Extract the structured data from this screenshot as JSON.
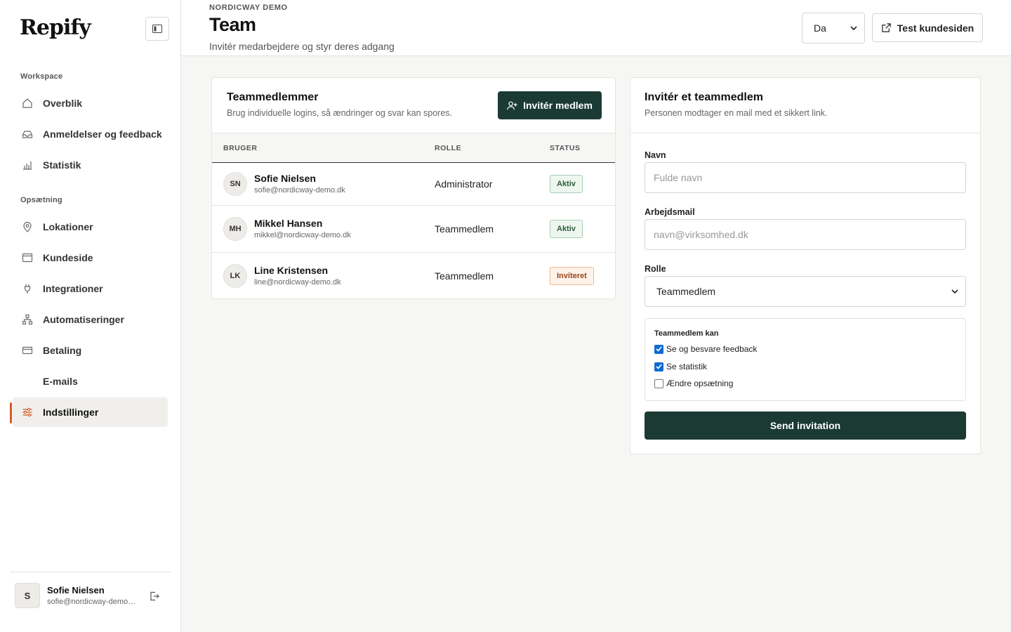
{
  "sidebar": {
    "logo": "Repify",
    "sections": {
      "workspace": "Workspace",
      "setup": "Opsætning"
    },
    "items": [
      {
        "label": "Overblik",
        "icon": "home-icon"
      },
      {
        "label": "Anmeldelser og feedback",
        "icon": "inbox-icon"
      },
      {
        "label": "Statistik",
        "icon": "bar-chart-icon"
      },
      {
        "label": "Lokationer",
        "icon": "map-pin-icon"
      },
      {
        "label": "Kundeside",
        "icon": "browser-window-icon"
      },
      {
        "label": "Integrationer",
        "icon": "plug-icon"
      },
      {
        "label": "Automatiseringer",
        "icon": "workflow-icon"
      },
      {
        "label": "Betaling",
        "icon": "credit-card-icon"
      },
      {
        "label": "E-mails",
        "icon": ""
      },
      {
        "label": "Indstillinger",
        "icon": "sliders-icon",
        "active": true
      }
    ],
    "user": {
      "initial": "S",
      "name": "Sofie Nielsen",
      "email": "sofie@nordicway-demo.dk"
    }
  },
  "header": {
    "org": "NORDICWAY DEMO",
    "title": "Team",
    "subtitle": "Invitér medarbejdere og styr deres adgang",
    "language": "Da",
    "test_button": "Test kundesiden"
  },
  "team": {
    "title": "Teammedlemmer",
    "subtitle": "Brug individuelle logins, så ændringer og svar kan spores.",
    "invite_button": "Invitér medlem",
    "columns": [
      "BRUGER",
      "ROLLE",
      "STATUS"
    ],
    "members": [
      {
        "initials": "SN",
        "name": "Sofie Nielsen",
        "email": "sofie@nordicway-demo.dk",
        "role": "Administrator",
        "status": "Aktiv"
      },
      {
        "initials": "MH",
        "name": "Mikkel Hansen",
        "email": "mikkel@nordicway-demo.dk",
        "role": "Teammedlem",
        "status": "Aktiv"
      },
      {
        "initials": "LK",
        "name": "Line Kristensen",
        "email": "line@nordicway-demo.dk",
        "role": "Teammedlem",
        "status": "Inviteret"
      }
    ]
  },
  "invite": {
    "title": "Invitér et teammedlem",
    "subtitle": "Personen modtager en mail med et sikkert link.",
    "name_label": "Navn",
    "name_placeholder": "Fulde navn",
    "email_label": "Arbejdsmail",
    "email_placeholder": "navn@virksomhed.dk",
    "role_label": "Rolle",
    "role_value": "Teammedlem",
    "permissions_title": "Teammedlem kan",
    "permissions": [
      {
        "label": "Se og besvare feedback",
        "checked": true
      },
      {
        "label": "Se statistik",
        "checked": true
      },
      {
        "label": "Ændre opsætning",
        "checked": false
      }
    ],
    "send_button": "Send invitation"
  },
  "colors": {
    "accent": "#d25b2b",
    "primary": "#1b3a34"
  }
}
